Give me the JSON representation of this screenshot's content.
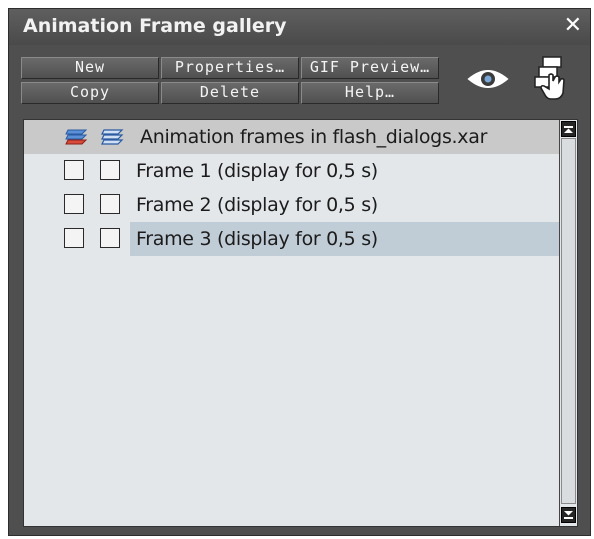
{
  "panel": {
    "title": "Animation Frame gallery",
    "close_glyph": "✕"
  },
  "toolbar": {
    "new_label": "New",
    "properties_label": "Properties…",
    "gif_preview_label": "GIF Preview…",
    "copy_label": "Copy",
    "delete_label": "Delete",
    "help_label": "Help…",
    "show_icon": "eye-icon",
    "options_icon": "layers-hand-icon"
  },
  "list": {
    "header": {
      "label": "Animation frames in flash_dialogs.xar",
      "icon": "layers-stack-icon"
    },
    "items": [
      {
        "label": "Frame 1 (display for 0,5 s)",
        "selected": false
      },
      {
        "label": "Frame 2 (display for 0,5 s)",
        "selected": false
      },
      {
        "label": "Frame 3 (display for 0,5 s)",
        "selected": true
      }
    ]
  },
  "colors": {
    "panel_bg": "#4f4f4f",
    "list_bg": "#e3e7ea",
    "header_row": "#c9c9c9",
    "selected_row": "#c0ccd6"
  }
}
